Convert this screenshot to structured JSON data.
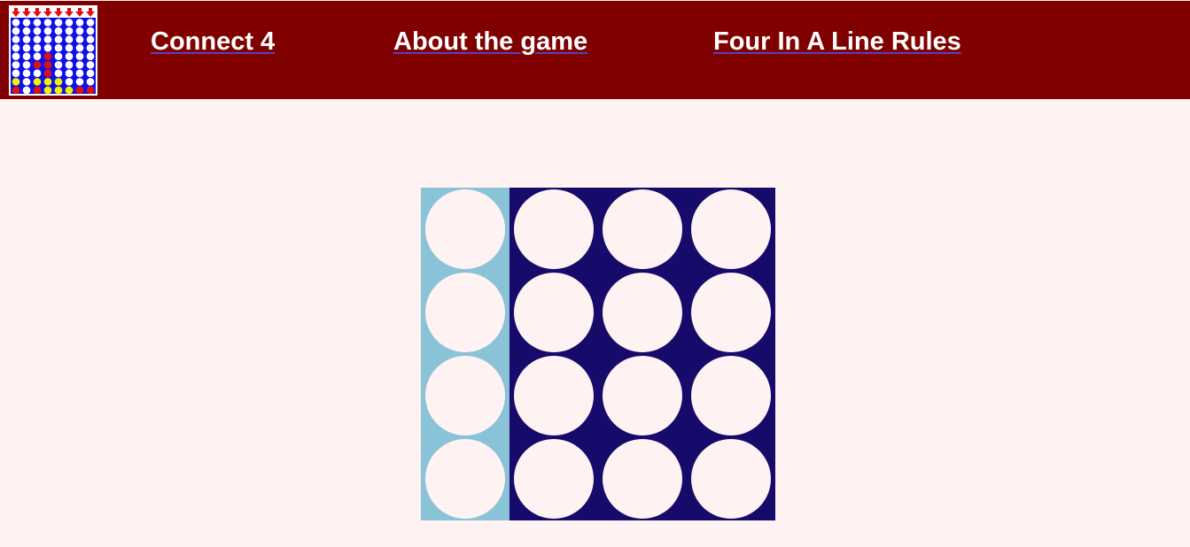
{
  "header": {
    "logo_icon": "connect-four-board-icon",
    "nav": [
      {
        "label": "Connect 4"
      },
      {
        "label": "About the game"
      },
      {
        "label": "Four In A Line Rules"
      }
    ]
  },
  "colors": {
    "header_bg": "#800000",
    "page_bg": "#fff2f2",
    "board": "#160a6a",
    "board_hover": "#8ac2d8",
    "empty_slot": "#fff2f2",
    "logo_board": "#1010e6",
    "logo_red": "#e01010",
    "logo_yellow": "#f2f200",
    "logo_empty": "#ffffff"
  },
  "board": {
    "columns": 4,
    "rows": 4,
    "highlighted_column": 0,
    "cells": [
      [
        "empty",
        "empty",
        "empty",
        "empty"
      ],
      [
        "empty",
        "empty",
        "empty",
        "empty"
      ],
      [
        "empty",
        "empty",
        "empty",
        "empty"
      ],
      [
        "empty",
        "empty",
        "empty",
        "empty"
      ]
    ]
  },
  "logo_grid": [
    [
      "empty",
      "empty",
      "empty",
      "empty",
      "empty",
      "empty",
      "empty",
      "empty"
    ],
    [
      "empty",
      "empty",
      "empty",
      "empty",
      "empty",
      "empty",
      "empty",
      "empty"
    ],
    [
      "empty",
      "empty",
      "empty",
      "empty",
      "empty",
      "empty",
      "empty",
      "empty"
    ],
    [
      "empty",
      "empty",
      "empty",
      "empty",
      "empty",
      "empty",
      "empty",
      "empty"
    ],
    [
      "empty",
      "empty",
      "empty",
      "red",
      "empty",
      "empty",
      "empty",
      "empty"
    ],
    [
      "empty",
      "empty",
      "red",
      "red",
      "empty",
      "empty",
      "empty",
      "empty"
    ],
    [
      "empty",
      "empty",
      "empty",
      "red",
      "empty",
      "empty",
      "empty",
      "empty"
    ],
    [
      "yellow",
      "empty",
      "yellow",
      "yellow",
      "yellow",
      "empty",
      "empty",
      "empty"
    ],
    [
      "red",
      "empty",
      "red",
      "yellow",
      "yellow",
      "yellow",
      "red",
      "red"
    ]
  ]
}
